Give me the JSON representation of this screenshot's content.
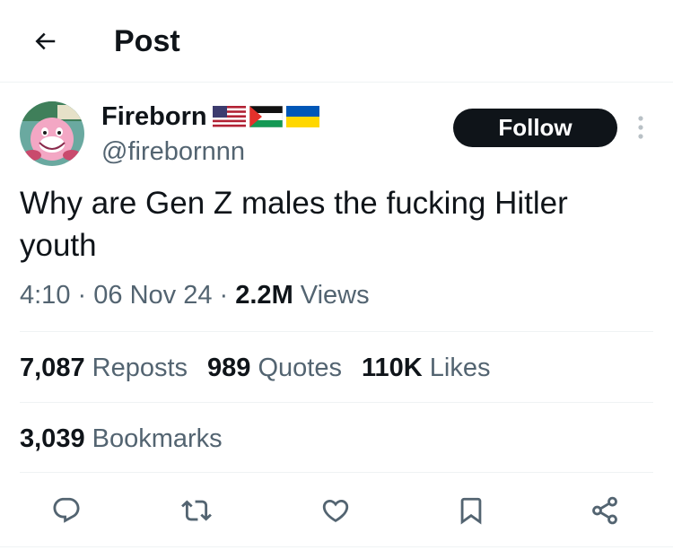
{
  "header": {
    "title": "Post",
    "back_icon": "arrow-left-icon"
  },
  "author": {
    "display_name": "Fireborn",
    "handle": "@firebornnn",
    "flags": [
      "us-flag",
      "palestine-flag",
      "ukraine-flag"
    ],
    "follow_label": "Follow"
  },
  "tweet": {
    "text": "Why are Gen Z males the fucking Hitler\nyouth",
    "time": "4:10",
    "separator": "·",
    "date": "06 Nov 24",
    "views_count": "2.2M",
    "views_label": "Views"
  },
  "stats": {
    "reposts_count": "7,087",
    "reposts_label": "Reposts",
    "quotes_count": "989",
    "quotes_label": "Quotes",
    "likes_count": "110K",
    "likes_label": "Likes",
    "bookmarks_count": "3,039",
    "bookmarks_label": "Bookmarks"
  },
  "actions": [
    "reply-icon",
    "repost-icon",
    "like-icon",
    "bookmark-icon",
    "share-icon"
  ],
  "colors": {
    "text": "#0f1419",
    "secondary": "#536471",
    "divider": "#eff3f4",
    "button_bg": "#0f1419"
  }
}
